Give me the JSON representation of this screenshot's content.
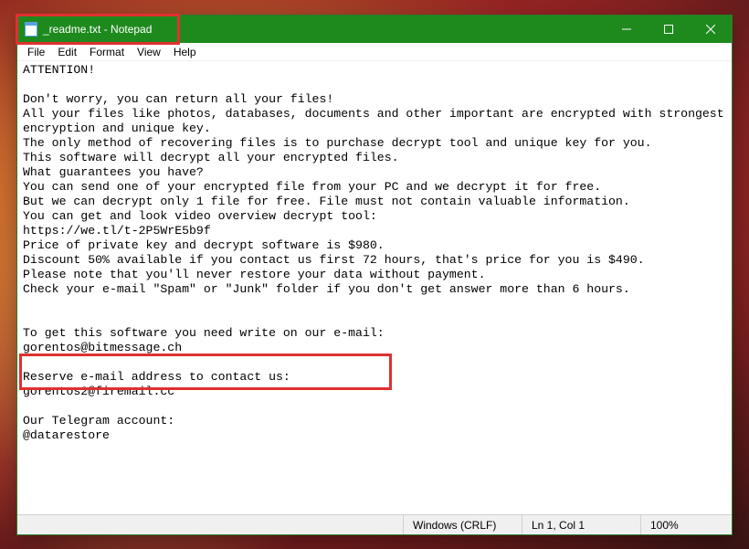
{
  "window": {
    "title": "_readme.txt - Notepad"
  },
  "menu": {
    "file": "File",
    "edit": "Edit",
    "format": "Format",
    "view": "View",
    "help": "Help"
  },
  "body": {
    "text": "ATTENTION!\n\nDon't worry, you can return all your files!\nAll your files like photos, databases, documents and other important are encrypted with strongest encryption and unique key.\nThe only method of recovering files is to purchase decrypt tool and unique key for you.\nThis software will decrypt all your encrypted files.\nWhat guarantees you have?\nYou can send one of your encrypted file from your PC and we decrypt it for free.\nBut we can decrypt only 1 file for free. File must not contain valuable information.\nYou can get and look video overview decrypt tool:\nhttps://we.tl/t-2P5WrE5b9f\nPrice of private key and decrypt software is $980.\nDiscount 50% available if you contact us first 72 hours, that's price for you is $490.\nPlease note that you'll never restore your data without payment.\nCheck your e-mail \"Spam\" or \"Junk\" folder if you don't get answer more than 6 hours.\n\n\nTo get this software you need write on our e-mail:\ngorentos@bitmessage.ch\n\nReserve e-mail address to contact us:\ngorentos2@firemail.cc\n\nOur Telegram account:\n@datarestore"
  },
  "status": {
    "encoding": "Windows (CRLF)",
    "position": "Ln 1, Col 1",
    "zoom": "100%"
  }
}
